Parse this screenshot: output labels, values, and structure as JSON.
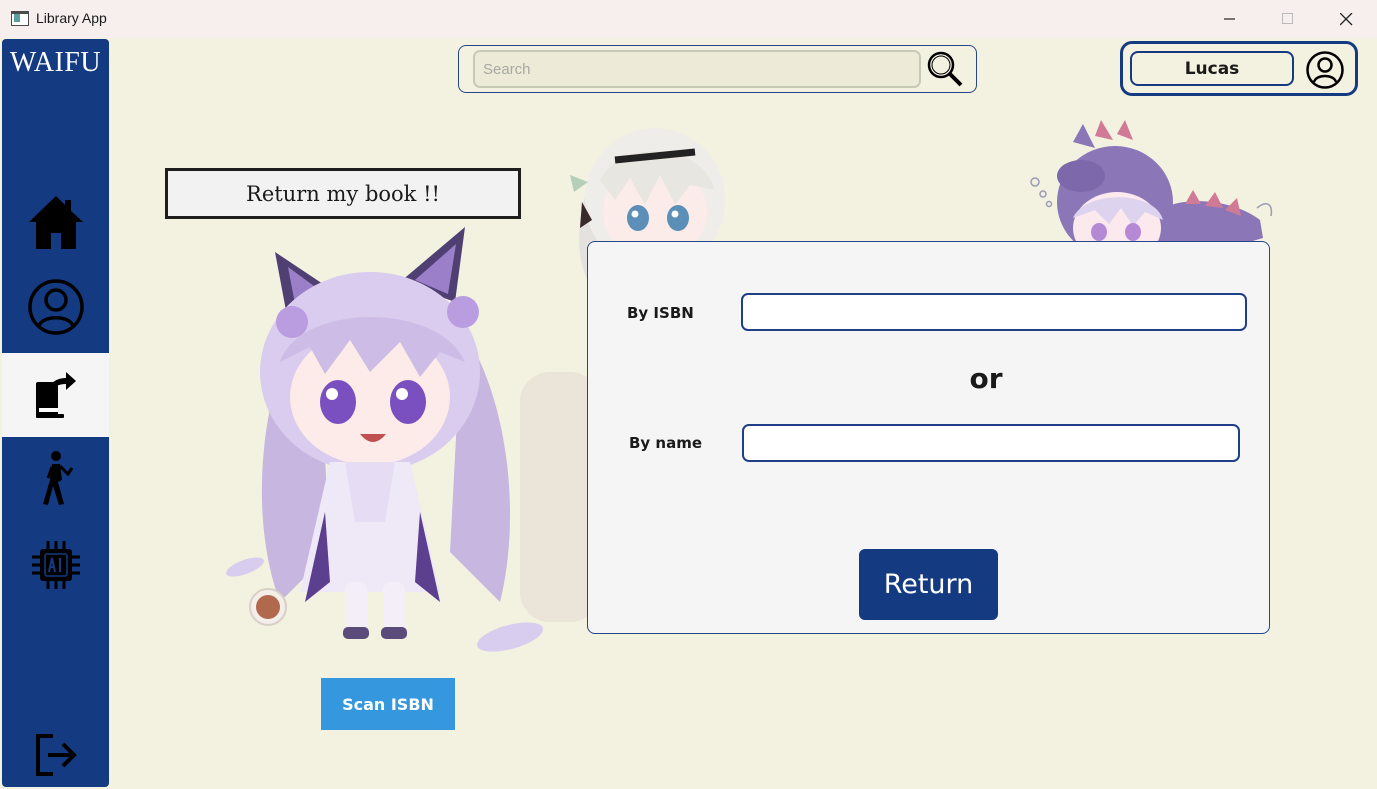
{
  "window": {
    "title": "Library App"
  },
  "sidebar": {
    "brand": "WAIFU",
    "items": [
      {
        "icon": "home-icon"
      },
      {
        "icon": "user-circle-icon"
      },
      {
        "icon": "book-return-icon",
        "active": true
      },
      {
        "icon": "walking-person-icon"
      },
      {
        "icon": "ai-chip-icon"
      },
      {
        "icon": "logout-icon"
      }
    ]
  },
  "search": {
    "placeholder": "Search",
    "value": ""
  },
  "user": {
    "name": "Lucas"
  },
  "page": {
    "heading": "Return my book !!"
  },
  "form": {
    "isbn_label": "By ISBN",
    "isbn_value": "",
    "or_text": "or",
    "name_label": "By name",
    "name_value": "",
    "return_label": "Return"
  },
  "scan": {
    "label": "Scan ISBN"
  },
  "colors": {
    "sidebar": "#143a82",
    "background": "#f3f1df",
    "return_button": "#143a82",
    "scan_button": "#3597dd",
    "panel": "#f5f5f5"
  }
}
